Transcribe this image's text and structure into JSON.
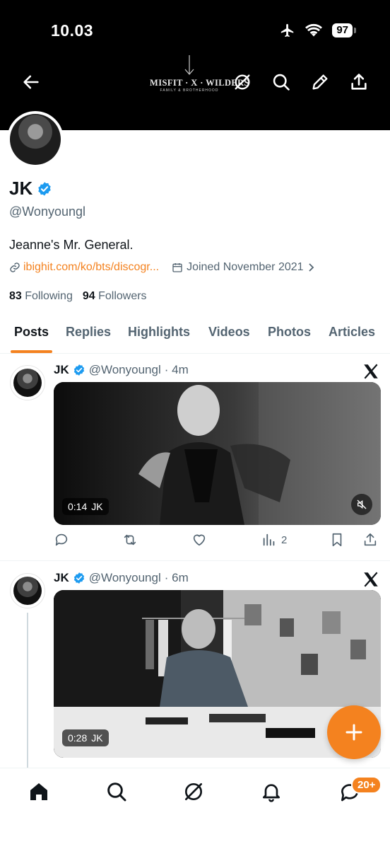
{
  "status_bar": {
    "time": "10.03",
    "battery": "97"
  },
  "banner": {
    "logo_main": "MISFIT · X · WILDERS",
    "logo_sub": "FAMILY & BROTHERHOOD"
  },
  "profile": {
    "name": "JK",
    "handle": "@Wonyoungl",
    "bio": "Jeanne's Mr. General.",
    "link": "ibighit.com/ko/bts/discogr...",
    "joined": "Joined November 2021",
    "following_count": "83",
    "following_label": "Following",
    "followers_count": "94",
    "followers_label": "Followers"
  },
  "tabs": [
    "Posts",
    "Replies",
    "Highlights",
    "Videos",
    "Photos",
    "Articles"
  ],
  "posts": [
    {
      "name": "JK",
      "handle": "@Wonyoungl",
      "time": "· 4m",
      "duration": "0:14",
      "media_label": "JK",
      "views": "2"
    },
    {
      "name": "JK",
      "handle": "@Wonyoungl",
      "time": "· 6m",
      "duration": "0:28",
      "media_label": "JK"
    }
  ],
  "bottom_nav": {
    "notification_badge": "20+"
  },
  "colors": {
    "accent": "#f4821f",
    "verified": "#1d9bf0",
    "text_secondary": "#536471"
  },
  "icons": [
    "back-arrow-icon",
    "grok-icon",
    "search-icon",
    "edit-icon",
    "share-icon",
    "verified-icon",
    "link-icon",
    "calendar-icon",
    "x-logo-icon",
    "reply-icon",
    "repost-icon",
    "like-icon",
    "views-icon",
    "bookmark-icon",
    "mute-icon",
    "home-icon",
    "bell-icon",
    "messages-icon",
    "plus-icon"
  ]
}
